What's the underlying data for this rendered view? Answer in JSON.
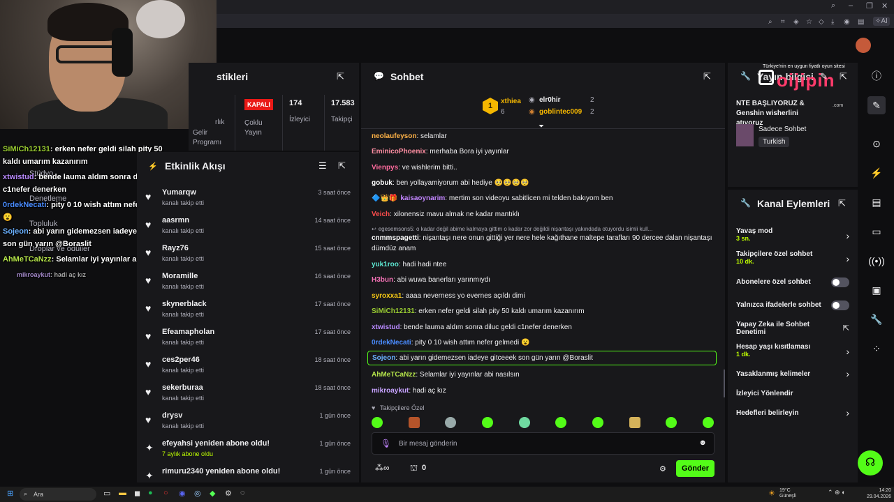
{
  "stats": {
    "title_fragment": "stikleri",
    "label_frag": "rlık",
    "gelir": "Gelir Programı",
    "badge": "KAPALI",
    "multi": "Çoklu Yayın",
    "viewers_value": "174",
    "viewers_label": "İzleyici",
    "followers_value": "17.583",
    "followers_label": "Takipçi"
  },
  "activity": {
    "title": "Etkinlik Akışı",
    "items": [
      {
        "name": "Yumarqw",
        "sub": "kanalı takip etti",
        "time": "3 saat önce",
        "icon": "heart-icon"
      },
      {
        "name": "aasrmn",
        "sub": "kanalı takip etti",
        "time": "14 saat önce",
        "icon": "heart-icon"
      },
      {
        "name": "Rayz76",
        "sub": "kanalı takip etti",
        "time": "15 saat önce",
        "icon": "heart-icon"
      },
      {
        "name": "Moramille",
        "sub": "kanalı takip etti",
        "time": "16 saat önce",
        "icon": "heart-icon"
      },
      {
        "name": "skynerblack",
        "sub": "kanalı takip etti",
        "time": "17 saat önce",
        "icon": "heart-icon"
      },
      {
        "name": "Efeamapholan",
        "sub": "kanalı takip etti",
        "time": "17 saat önce",
        "icon": "heart-icon"
      },
      {
        "name": "ces2per46",
        "sub": "kanalı takip etti",
        "time": "18 saat önce",
        "icon": "heart-icon"
      },
      {
        "name": "sekerburaa",
        "sub": "kanalı takip etti",
        "time": "18 saat önce",
        "icon": "heart-icon"
      },
      {
        "name": "drysv",
        "sub": "kanalı takip etti",
        "time": "1 gün önce",
        "icon": "heart-icon"
      },
      {
        "name": "efeyahsi yeniden abone oldu!",
        "sub": "7 aylık abone oldu",
        "time": "1 gün önce",
        "icon": "sparkle-icon"
      },
      {
        "name": "rimuru2340 yeniden abone oldu!",
        "sub": "",
        "time": "1 gün önce",
        "icon": "sparkle-icon"
      }
    ]
  },
  "sidenav": {
    "studyo": "Stüdyo",
    "denetleme": "Denetleme",
    "topluluk": "Topluluk",
    "droplar": "Droplar ve ödüller"
  },
  "overlay_chat": [
    {
      "user": "SiMiCh12131",
      "text": ": erken nefer geldi silah pity 50 kaldı umarım kazanırım",
      "color": "#9acd32"
    },
    {
      "user": "xtwistud",
      "text": ": bende lauma aldım sonra diluc geldi c1nefer denerken",
      "color": "#b98aff"
    },
    {
      "user": "0rdekNecati",
      "text": ": pity 0 10 wish attım nefer gelmedi 😮",
      "color": "#4a8cff"
    },
    {
      "user": "Sojeon",
      "text": ": abi yarın gidemezsen iadeye gitceeek son gün yarın @Boraslit",
      "color": "#6ab0ff"
    },
    {
      "user": "AhMeTCaNzz",
      "text": ": Selamlar iyi yayınlar abi nasılsın",
      "color": "#b4e34a"
    },
    {
      "user": "mikroaykut",
      "text": ": hadi aç kız",
      "color": "#c7a3ff"
    }
  ],
  "chat": {
    "title": "Sohbet",
    "leaderboard": {
      "rank": "1",
      "first_user": "xthiea",
      "first_count": "6",
      "second_user": "elr0hir",
      "second_count": "2",
      "third_user": "goblintec009",
      "third_count": "2"
    },
    "messages": [
      {
        "user": "neolaufeyson",
        "text": ": selamlar",
        "color": "#ffb347"
      },
      {
        "user": "EminicoPhoenix",
        "text": ": merhaba Bora iyi yayınlar",
        "color": "#ff8fa3"
      },
      {
        "user": "Vienpys",
        "text": ": ve wishlerim bitti..",
        "color": "#ff6b9d"
      },
      {
        "user": "gobuk",
        "text": ": ben yollayamiyorum abi hediye 🥺🥺🥺🥺",
        "color": "#ffffff"
      },
      {
        "user": "kaisaoynarim",
        "text": ": mertim son videoyu sabitlicen mi telden bakıyom ben",
        "color": "#c084fc"
      },
      {
        "user": "Veich",
        "text": ": xilonensiz mavu almak ne kadar mantıklı",
        "color": "#ff4d4d"
      },
      {
        "user": "egesemsons5",
        "text": ": o kadar değil abime kalmaya gittim o kadar zor değildi nişantaşı yakındada otuyordu isimli kull...",
        "color": "#adadb8"
      },
      {
        "user": "cnmmspagetti",
        "text": ": nişantaşı nere onun gittiği yer nere hele kağıthane maltepe tarafları 90 dercee dalan nişantaşı dümdüz anam",
        "color": "#ffffff"
      },
      {
        "user": "yuk1roo",
        "text": ": hadi hadi ntee",
        "color": "#5eead4"
      },
      {
        "user": "H3bun",
        "text": ": abi wuwa banerları yarınmıydı",
        "color": "#f472b6"
      },
      {
        "user": "syroxxa1",
        "text": ": aaaa neverness yo evernes açıldı dimi",
        "color": "#facc15"
      },
      {
        "user": "SiMiCh12131",
        "text": ": erken nefer geldi silah pity 50 kaldı umarım kazanırım",
        "color": "#9acd32"
      },
      {
        "user": "xtwistud",
        "text": ": bende lauma aldım sonra diluc geldi c1nefer denerken",
        "color": "#b98aff"
      },
      {
        "user": "0rdekNecati",
        "text": ": pity 0 10 wish attım nefer gelmedi 😮",
        "color": "#4a8cff"
      },
      {
        "user": "Sojeon",
        "text": ": abi yarın gidemezsen iadeye gitceeek son gün yarın @Boraslit",
        "color": "#6ab0ff"
      },
      {
        "user": "AhMeTCaNzz",
        "text": ": Selamlar iyi yayınlar abi nasılsın",
        "color": "#b4e34a"
      },
      {
        "user": "mikroaykut",
        "text": ": hadi aç kız",
        "color": "#c7a3ff"
      }
    ],
    "followers_only": "Takipçilere Özel",
    "input_placeholder": "Bir mesaj gönderin",
    "points_label": "0",
    "send_label": "Gönder"
  },
  "gameinfo": {
    "title": "Yayın bilgisi",
    "stream_title": "NTE BAŞLIYORUZ & Genshin wisherlini atıyoruz",
    "category": "Sadece Sohbet",
    "language": "Turkish",
    "sponsor_top": "Türkiye'nin en uygun fiyatlı oyun sitesi",
    "sponsor_logo": "oijipin",
    "sponsor_url": ".com"
  },
  "modactions": {
    "title": "Kanal Eylemleri",
    "items": [
      {
        "label": "Yavaş mod",
        "sub": "3 sn.",
        "control": "chevron"
      },
      {
        "label": "Takipçilere özel sohbet",
        "sub": "10 dk.",
        "control": "chevron"
      },
      {
        "label": "Abonelere özel sohbet",
        "sub": "",
        "control": "toggle"
      },
      {
        "label": "Yalnızca ifadelerle sohbet",
        "sub": "",
        "control": "toggle"
      },
      {
        "label": "Yapay Zeka ile Sohbet Denetimi",
        "sub": "",
        "control": "external"
      },
      {
        "label": "Hesap yaşı kısıtlaması",
        "sub": "1 dk.",
        "control": "chevron"
      },
      {
        "label": "Yasaklanmış kelimeler",
        "sub": "",
        "control": "chevron"
      },
      {
        "label": "İzleyici Yönlendir",
        "sub": "",
        "control": "none"
      },
      {
        "label": "Hedefleri belirleyin",
        "sub": "",
        "control": "chevron"
      }
    ]
  },
  "taskbar": {
    "search": "Ara",
    "weather": "19°C Güneşli",
    "time": "14:20",
    "date": "29.04.2026"
  },
  "colors": {
    "accent": "#53fc18",
    "bg": "#0e0e10",
    "panel": "#18181b",
    "badge_red": "#e91916"
  }
}
